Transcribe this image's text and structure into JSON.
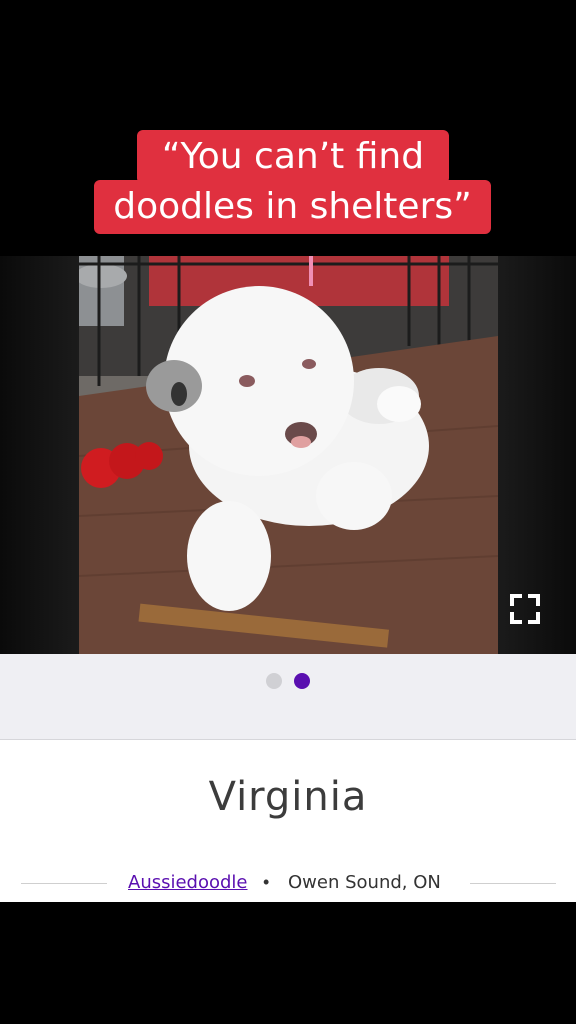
{
  "caption": {
    "line1": "“You can’t find",
    "line2": "doodles in shelters”",
    "bg_color": "#e0303f"
  },
  "gallery": {
    "photo_subject": "puppy-photo",
    "expand_icon": "expand-fullscreen-icon",
    "dots_total": 2,
    "active_dot_index": 1,
    "active_color": "#5a0fb0"
  },
  "pet": {
    "name": "Virginia",
    "breed": "Aussiedoodle",
    "separator": "•",
    "location": "Owen Sound, ON"
  }
}
